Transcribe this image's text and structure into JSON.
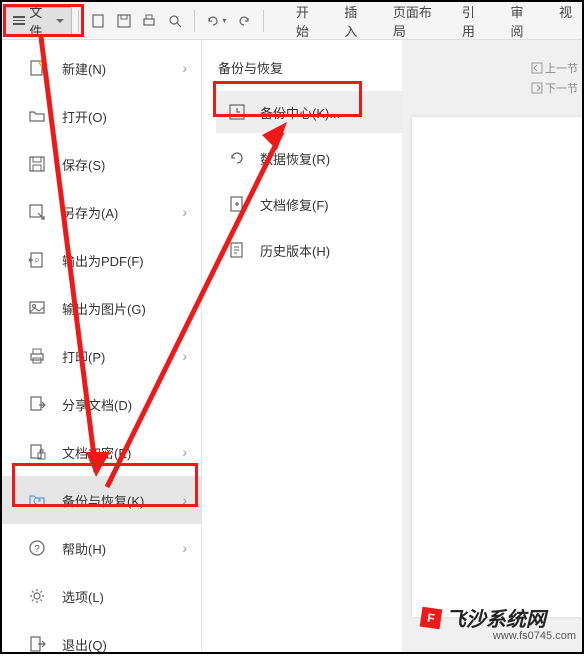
{
  "toolbar": {
    "file_label": "文件",
    "tabs": [
      "开始",
      "插入",
      "页面布局",
      "引用",
      "审阅",
      "视"
    ]
  },
  "side_hints": {
    "prev": "上一节",
    "next": "下一节"
  },
  "menu": {
    "items": [
      {
        "label": "新建(N)",
        "has_sub": true,
        "icon": "new"
      },
      {
        "label": "打开(O)",
        "has_sub": false,
        "icon": "open"
      },
      {
        "label": "保存(S)",
        "has_sub": false,
        "icon": "save"
      },
      {
        "label": "另存为(A)",
        "has_sub": true,
        "icon": "saveas"
      },
      {
        "label": "输出为PDF(F)",
        "has_sub": false,
        "icon": "pdf"
      },
      {
        "label": "输出为图片(G)",
        "has_sub": false,
        "icon": "image"
      },
      {
        "label": "打印(P)",
        "has_sub": true,
        "icon": "print"
      },
      {
        "label": "分享文档(D)",
        "has_sub": false,
        "icon": "share"
      },
      {
        "label": "文档加密(E)",
        "has_sub": true,
        "icon": "encrypt"
      },
      {
        "label": "备份与恢复(K)",
        "has_sub": true,
        "icon": "backup",
        "active": true
      },
      {
        "label": "帮助(H)",
        "has_sub": true,
        "icon": "help"
      },
      {
        "label": "选项(L)",
        "has_sub": false,
        "icon": "options"
      },
      {
        "label": "退出(Q)",
        "has_sub": false,
        "icon": "exit"
      }
    ]
  },
  "submenu": {
    "title": "备份与恢复",
    "items": [
      {
        "label": "备份中心(K)...",
        "icon": "backup-center",
        "highlighted": true
      },
      {
        "label": "数据恢复(R)",
        "icon": "data-recover"
      },
      {
        "label": "文档修复(F)",
        "icon": "doc-repair"
      },
      {
        "label": "历史版本(H)",
        "icon": "history"
      }
    ]
  },
  "watermark": {
    "brand": "飞沙系统网",
    "url": "www.fs0745.com"
  }
}
